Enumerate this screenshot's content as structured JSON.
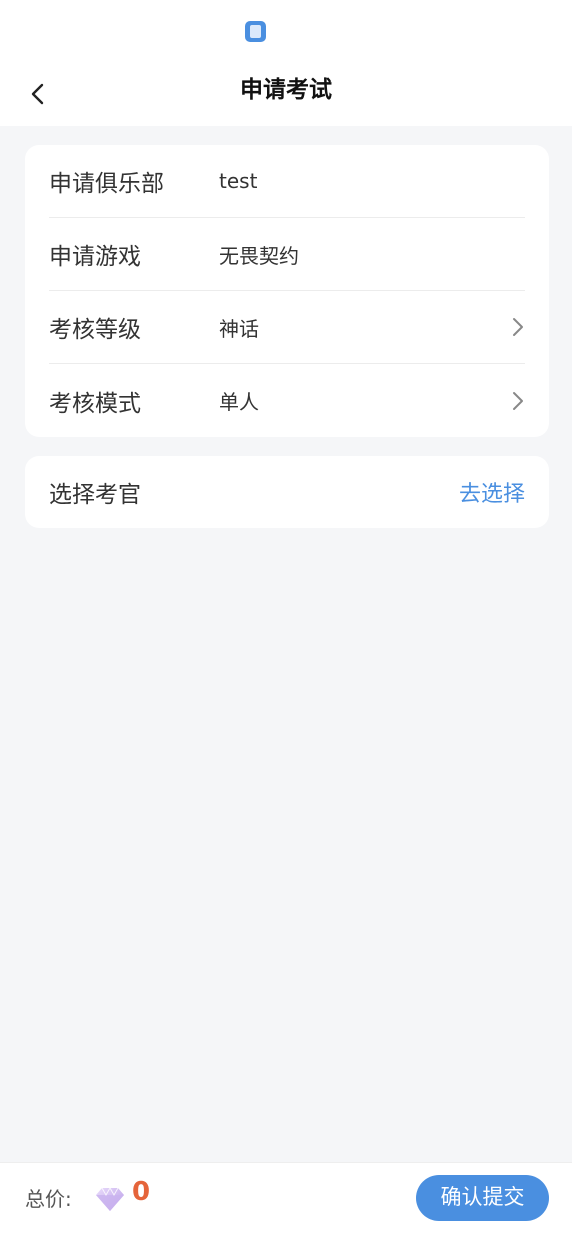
{
  "header": {
    "title": "申请考试",
    "back_icon": "chevron-left-icon"
  },
  "info_card": {
    "rows": [
      {
        "label": "申请俱乐部",
        "value": "test"
      },
      {
        "label": "申请游戏",
        "value": "无畏契约"
      },
      {
        "label": "考核等级",
        "value": "神话"
      },
      {
        "label": "考核模式",
        "value": "单人"
      }
    ]
  },
  "examiner_card": {
    "label": "选择考官",
    "action": "去选择"
  },
  "footer": {
    "total_label": "总价:",
    "total_value": "0",
    "submit_label": "确认提交"
  },
  "colors": {
    "accent": "#4a8fe0",
    "price": "#e5643a",
    "background": "#f5f6f8"
  }
}
